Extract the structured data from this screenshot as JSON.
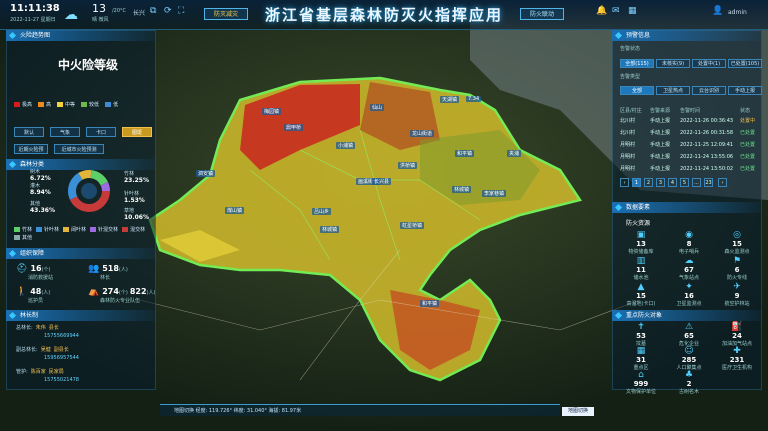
{
  "header": {
    "time": "11:11:38",
    "date": "2022-11-27 星期日",
    "title": "浙江省基层森林防灭火指挥应用",
    "weather_temp": "13",
    "weather_unit": "/20°C",
    "weather_text": "晴 微风",
    "location": "长兴",
    "tab_left": "防灭减灾",
    "tab_right": "防火联动",
    "user": "admin"
  },
  "left": {
    "danger_title": "火险趋势图",
    "danger_level": "中火险等级",
    "legend": [
      {
        "label": "极高",
        "color": "#d81b1b"
      },
      {
        "label": "高",
        "color": "#f08a1c"
      },
      {
        "label": "中等",
        "color": "#f3d23c"
      },
      {
        "label": "较低",
        "color": "#6fb84a"
      },
      {
        "label": "低",
        "color": "#3d8bd6"
      }
    ],
    "buttons": [
      "默认",
      "气象",
      "卡口",
      "图斑"
    ],
    "sub_buttons": [
      "近期火险预",
      "近城市火险预测"
    ],
    "forest_title": "森林分类",
    "pcts": [
      {
        "name": "树木",
        "value": "6.72%"
      },
      {
        "name": "灌木",
        "value": "8.94%"
      },
      {
        "name": "其他",
        "value": "43.36%"
      },
      {
        "name": "竹林",
        "value": "23.25%"
      },
      {
        "name": "针叶林",
        "value": "1.53%"
      },
      {
        "name": "草地",
        "value": "10.06%"
      }
    ],
    "forest_legend": [
      "竹林",
      "针叶林",
      "阔叶林",
      "针混交林",
      "混交林",
      "其他"
    ],
    "org_title": "组织保障",
    "org": [
      {
        "num": "16",
        "unit": "(个)",
        "label": "消防救援站"
      },
      {
        "num": "518",
        "unit": "(人)",
        "label": "林长"
      },
      {
        "num": "48",
        "unit": "(人)",
        "label": "巡护员"
      },
      {
        "num": "274",
        "unit": "(个)",
        "num2": "822",
        "unit2": "(人)",
        "label": "森林防火专业队伍"
      }
    ],
    "leader_title": "林长制",
    "leaders": [
      {
        "role": "总林长:",
        "name": "朱伟",
        "title": "县长",
        "phone": "15755669944"
      },
      {
        "role": "副总林长:",
        "name": "吴健",
        "title": "副县长",
        "phone": "15956957544"
      },
      {
        "role": "管护:",
        "name": "陈百家",
        "title": "民家局",
        "phone": "15755021478"
      }
    ]
  },
  "right": {
    "warn_title": "预警信息",
    "status_label": "告警状态",
    "status_tabs": [
      "全部(115)",
      "未核实(9)",
      "处置中(1)",
      "已处置(105)"
    ],
    "type_label": "告警类型",
    "type_tabs": [
      "全部",
      "卫星热点",
      "云台识别",
      "手动上报"
    ],
    "cols": [
      "区县/村庄",
      "告警来源",
      "告警时间",
      "状态"
    ],
    "rows": [
      {
        "place": "北川村",
        "src": "手动上报",
        "time": "2022-11-26 00:36:43",
        "st": "处置中"
      },
      {
        "place": "北川村",
        "src": "手动上报",
        "time": "2022-11-26 00:31:58",
        "st": "已处置"
      },
      {
        "place": "月明村",
        "src": "手动上报",
        "time": "2022-11-25 12:09:41",
        "st": "已处置"
      },
      {
        "place": "月明村",
        "src": "手动上报",
        "time": "2022-11-24 13:55:06",
        "st": "已处置"
      },
      {
        "place": "月明村",
        "src": "手动上报",
        "time": "2022-11-24 13:50:02",
        "st": "已处置"
      }
    ],
    "pages": [
      "1",
      "2",
      "3",
      "4",
      "5",
      "...",
      "23"
    ],
    "res_title": "数据要素",
    "fire_res": "防火资源",
    "res": [
      {
        "num": "13",
        "label": "物资储备库",
        "icon": "▣"
      },
      {
        "num": "8",
        "label": "电子哨兵",
        "icon": "◉"
      },
      {
        "num": "15",
        "label": "森火监测点",
        "icon": "◎"
      },
      {
        "num": "11",
        "label": "储水池",
        "icon": "▥"
      },
      {
        "num": "67",
        "label": "气象站点",
        "icon": "☁"
      },
      {
        "num": "6",
        "label": "防火专线",
        "icon": "⚑"
      },
      {
        "num": "15",
        "label": "高温地(卡口)",
        "icon": "▲"
      },
      {
        "num": "16",
        "label": "卫星监测点",
        "icon": "✦"
      },
      {
        "num": "9",
        "label": "航空护林站",
        "icon": "✈"
      }
    ],
    "key_title": "重点防火对象",
    "key": [
      {
        "num": "53",
        "label": "坟墓",
        "icon": "✝"
      },
      {
        "num": "65",
        "label": "危化企业",
        "icon": "⚠"
      },
      {
        "num": "24",
        "label": "加油加气站点",
        "icon": "⛽"
      },
      {
        "num": "31",
        "label": "重点区",
        "icon": "▦"
      },
      {
        "num": "285",
        "label": "人口聚集点",
        "icon": "☺"
      },
      {
        "num": "231",
        "label": "医疗卫生机构",
        "icon": "✚"
      },
      {
        "num": "999",
        "label": "文物保护单位",
        "icon": "⌂"
      },
      {
        "num": "2",
        "label": "古树名木",
        "icon": "♣"
      }
    ]
  },
  "map_labels": [
    "梅园镇",
    "鼎甲桥",
    "仙山",
    "天湖镇",
    "龙山街道",
    "小浦镇",
    "洪桥镇",
    "画溪街道",
    "泗安镇",
    "长兴县",
    "和平镇",
    "虹星桥镇",
    "林城镇",
    "煤山镇",
    "夹浦",
    "吕山乡",
    "李家巷镇",
    "林城镇",
    "和平镇",
    "7.34"
  ],
  "bottom": {
    "text": "地图切换   经度: 119.726°  纬度: 31.040°  海拔: 81.97米",
    "ctrl": "地图切换"
  }
}
